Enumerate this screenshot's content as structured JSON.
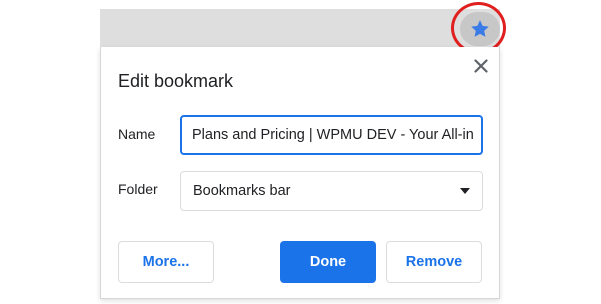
{
  "toolbar": {
    "star_icon": "star-icon",
    "star_color": "#3b7be8"
  },
  "dialog": {
    "title": "Edit bookmark",
    "name_label": "Name",
    "name_value": "Plans and Pricing | WPMU DEV - Your All-in",
    "folder_label": "Folder",
    "folder_value": "Bookmarks bar",
    "buttons": {
      "more": "More...",
      "done": "Done",
      "remove": "Remove"
    }
  },
  "colors": {
    "accent": "#1a73e8",
    "highlight": "#e01f1f"
  }
}
